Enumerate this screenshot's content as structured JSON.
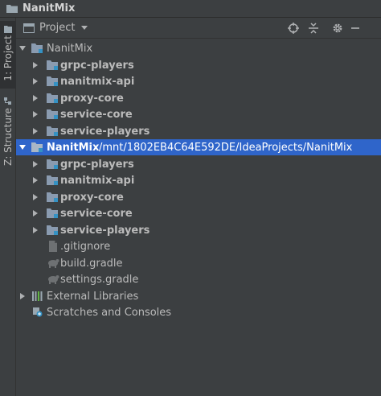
{
  "window": {
    "title": "NanitMix"
  },
  "stripe": {
    "project_tab": "1: Project",
    "structure_tab": "Z: Structure"
  },
  "panel": {
    "title": "Project"
  },
  "tree": {
    "root1": {
      "label": "NanitMix"
    },
    "root1_children": [
      "grpc-players",
      "nanitmix-api",
      "proxy-core",
      "service-core",
      "service-players"
    ],
    "root2": {
      "label": "NanitMix",
      "path": "/mnt/1802EB4C64E592DE/IdeaProjects/NanitMix"
    },
    "root2_children": [
      "grpc-players",
      "nanitmix-api",
      "proxy-core",
      "service-core",
      "service-players"
    ],
    "files": [
      ".gitignore",
      "build.gradle",
      "settings.gradle"
    ],
    "external": "External Libraries",
    "scratches": "Scratches and Consoles"
  },
  "colors": {
    "background": "#3c3f41",
    "selection": "#2f65ca",
    "text": "#bbbbbb",
    "folder_module": "#8a9bb0"
  }
}
